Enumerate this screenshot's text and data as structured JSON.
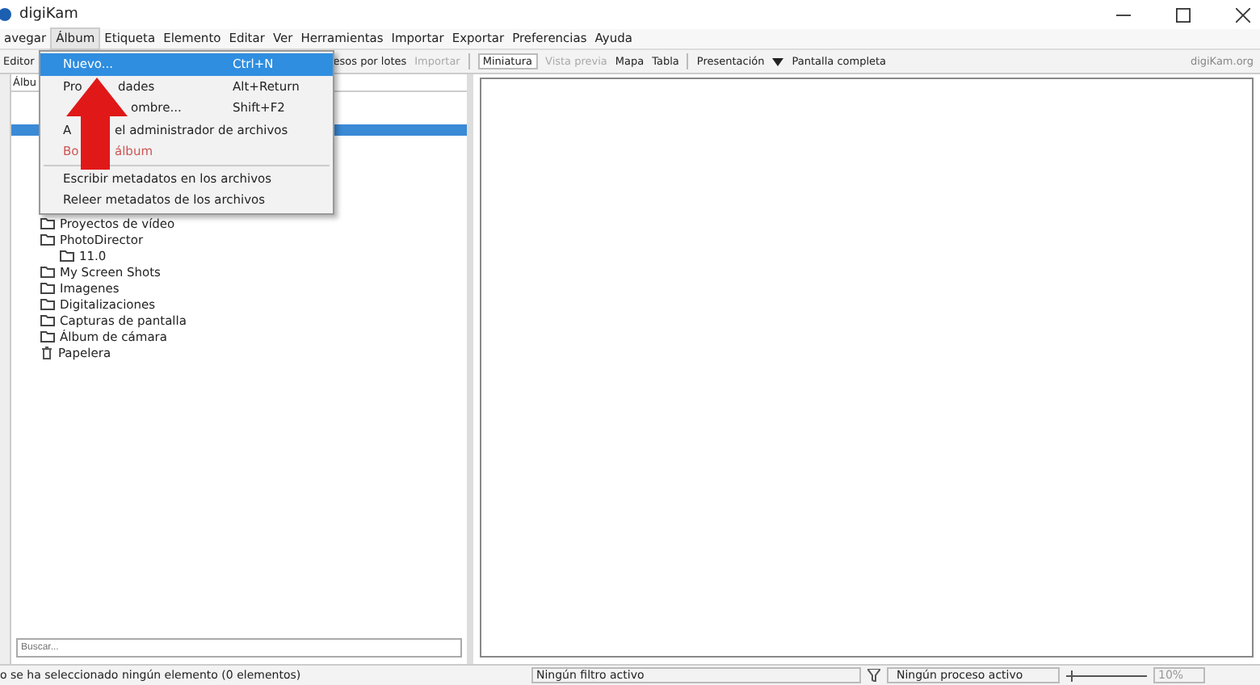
{
  "window": {
    "title": "digiKam"
  },
  "menubar": [
    {
      "label": "avegar",
      "selected": false
    },
    {
      "label": "Álbum",
      "selected": true
    },
    {
      "label": "Etiqueta",
      "selected": false
    },
    {
      "label": "Elemento",
      "selected": false
    },
    {
      "label": "Editar",
      "selected": false
    },
    {
      "label": "Ver",
      "selected": false
    },
    {
      "label": "Herramientas",
      "selected": false
    },
    {
      "label": "Importar",
      "selected": false
    },
    {
      "label": "Exportar",
      "selected": false
    },
    {
      "label": "Preferencias",
      "selected": false
    },
    {
      "label": "Ayuda",
      "selected": false
    }
  ],
  "toolbar": {
    "left": [
      {
        "label": "Editor",
        "disabled": false
      },
      {
        "label": "esos por lotes",
        "disabled": false
      },
      {
        "label": "Importar",
        "disabled": true
      }
    ],
    "views": [
      {
        "label": "Miniatura",
        "selected": true,
        "disabled": false
      },
      {
        "label": "Vista previa",
        "selected": false,
        "disabled": true
      },
      {
        "label": "Mapa",
        "selected": false,
        "disabled": false
      },
      {
        "label": "Tabla",
        "selected": false,
        "disabled": false
      }
    ],
    "presentation": "Presentación",
    "fullscreen": "Pantalla completa",
    "brand": "digiKam.org"
  },
  "album_menu": [
    {
      "label": [
        "Nuevo..."
      ],
      "shortcut": "Ctrl+N",
      "selected": true,
      "disabled": false
    },
    {
      "label": [
        "Pro",
        "dades"
      ],
      "shortcut": "Alt+Return",
      "selected": false,
      "disabled": false
    },
    {
      "label": [
        "ombre..."
      ],
      "shortcut": "Shift+F2",
      "selected": false,
      "disabled": false
    },
    {
      "label": [
        "A",
        "el administrador de archivos"
      ],
      "selected": false,
      "disabled": false
    },
    {
      "label": [
        "Bo",
        "álbum"
      ],
      "selected": false,
      "disabled": true
    },
    {
      "label": [
        "Escribir metadatos en los archivos"
      ],
      "selected": false,
      "disabled": false,
      "separator_before": true
    },
    {
      "label": [
        "Releer metadatos de los archivos"
      ],
      "selected": false,
      "disabled": false,
      "separator_before": false
    }
  ],
  "album_panel": {
    "header": "Álbu",
    "tree": [
      {
        "label": "Proyectos de vídeo"
      },
      {
        "label": "PhotoDirector",
        "children": [
          {
            "label": "11.0"
          }
        ]
      },
      {
        "label": "My Screen Shots"
      },
      {
        "label": "Imagenes"
      },
      {
        "label": "Digitalizaciones"
      },
      {
        "label": "Capturas de pantalla"
      },
      {
        "label": "Álbum de cámara"
      },
      {
        "label": "Papelera",
        "kind": "trash"
      }
    ],
    "search": {
      "placeholder": "Buscar..."
    }
  },
  "status_bar": {
    "selection": "o se ha seleccionado ningún elemento (0 elementos)",
    "filter": "Ningún filtro activo",
    "process": "Ningún proceso activo",
    "zoom_slider": {
      "level": 0.05
    },
    "zoom": "10%"
  }
}
